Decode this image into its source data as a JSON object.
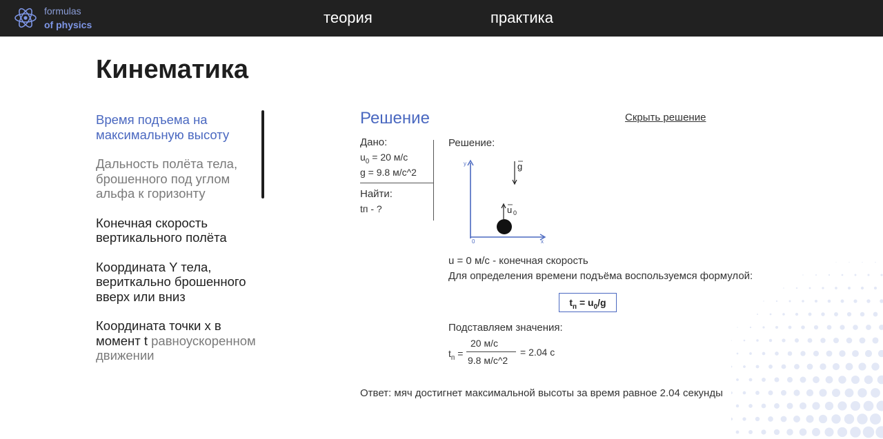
{
  "logo": {
    "line1": "formulas",
    "line2": "of physics"
  },
  "nav": {
    "theory": "теория",
    "practice": "практика"
  },
  "page_title": "Кинематика",
  "sidebar": {
    "items": [
      {
        "label": "Время подъема на максимальную высоту"
      },
      {
        "label": "Дальность полёта тела, брошенного под углом альфа к горизонту"
      },
      {
        "label": "Конечная скорость вертикального полёта"
      },
      {
        "label": "Координата Y тела, вериткально брошенного вверх или вниз"
      },
      {
        "part1": "Координата точки x в момент t",
        "part2": "равноускоренном движении"
      }
    ]
  },
  "solution": {
    "heading": "Решение",
    "hide_link": "Скрыть решение",
    "given": {
      "title": "Дано:",
      "v0_symbol": "u",
      "v0_sub": "0",
      "v0_value": " = 20 м/с",
      "g_line": "g  = 9.8 м/с^2",
      "find_title": "Найти:",
      "find_value": "tп  - ?"
    },
    "solution_label": "Решение:",
    "diagram": {
      "y_label": "y",
      "x_label": "x",
      "origin": "0",
      "g_label": "g",
      "v_label": "u",
      "v_sub": "0"
    },
    "final_speed": "u = 0 м/с - конечная скорость",
    "formula_intro": "Для определения времени подъёма воспользуемся формулой:",
    "formula": {
      "t": "t",
      "t_sub": "п",
      "rest": " = u",
      "v_sub": "0",
      "tail": "/g"
    },
    "substitute": "Подставляем значения:",
    "fraction": {
      "t": "t",
      "t_sub": "п",
      "eq": " =",
      "numerator": "20 м/с",
      "denominator": "9.8 м/с^2",
      "result": "= 2.04 с"
    },
    "answer": "Ответ: мяч достигнет максимальной высоты за время равное 2.04 секунды"
  }
}
